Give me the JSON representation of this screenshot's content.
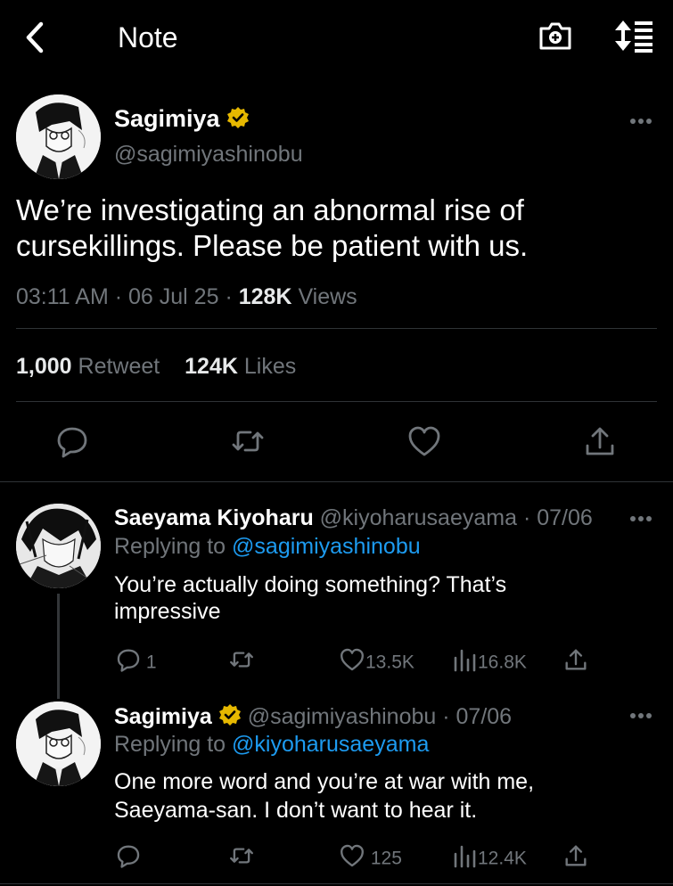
{
  "header": {
    "title": "Note"
  },
  "tweet": {
    "name": "Sagimiya",
    "handle": "@sagimiyashinobu",
    "text": "We’re investigating an abnormal rise of cursekillings. Please be patient with us.",
    "time": "03:11 AM",
    "date": "06 Jul 25",
    "views_count": "128K",
    "views_label": "Views",
    "retweet_count": "1,000",
    "retweet_label": "Retweet",
    "likes_count": "124K",
    "likes_label": "Likes"
  },
  "replies": [
    {
      "name": "Saeyama Kiyoharu",
      "handle": "@kiyoharusaeyama",
      "date": "· 07/06",
      "replying_prefix": "Replying to",
      "replying_to": "@sagimiyashinobu",
      "text_line1": "You’re actually doing something? That’s",
      "text_line2": "impressive",
      "reply_count": "1",
      "like_count": "13.5K",
      "view_count": "16.8K"
    },
    {
      "name": "Sagimiya",
      "handle": "@sagimiyashinobu",
      "date": "· 07/06",
      "replying_prefix": "Replying to",
      "replying_to": "@kiyoharusaeyama",
      "text_line1": "One more word and you’re at war with me,",
      "text_line2": "Saeyama-san. I don’t want to hear it.",
      "reply_count": "",
      "like_count": "125",
      "view_count": "12.4K"
    }
  ],
  "colors": {
    "background": "#000000",
    "text": "#e7e9ea",
    "muted": "#71767b",
    "link": "#1d9bf0",
    "verified": "#e6b800",
    "divider": "#2f3336"
  },
  "icons": [
    "back-icon",
    "camera-icon",
    "sort-icon",
    "more-icon",
    "verified-icon",
    "reply-icon",
    "retweet-icon",
    "like-icon",
    "share-icon",
    "views-icon"
  ]
}
